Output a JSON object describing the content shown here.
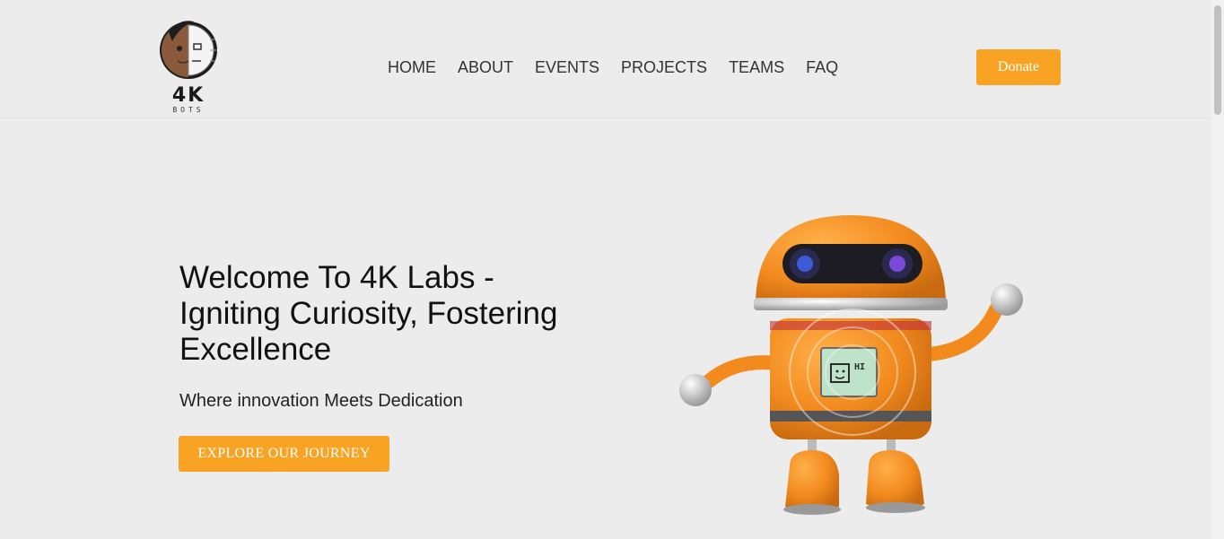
{
  "header": {
    "logo": {
      "text": "4K",
      "subtext": "BOTS"
    },
    "nav": [
      "HOME",
      "ABOUT",
      "EVENTS",
      "PROJECTS",
      "TEAMS",
      "FAQ"
    ],
    "donate_label": "Donate"
  },
  "hero": {
    "title_line1": "Welcome To 4K Labs -",
    "title_line2": "Igniting Curiosity, Fostering",
    "title_line3": "Excellence",
    "subtitle": "Where innovation Meets Dedication",
    "cta_label": "EXPLORE OUR JOURNEY",
    "robot_screen_text": "HI"
  },
  "colors": {
    "accent": "#f8a324",
    "background": "#ececec",
    "robot_orange": "#f28a1e"
  }
}
